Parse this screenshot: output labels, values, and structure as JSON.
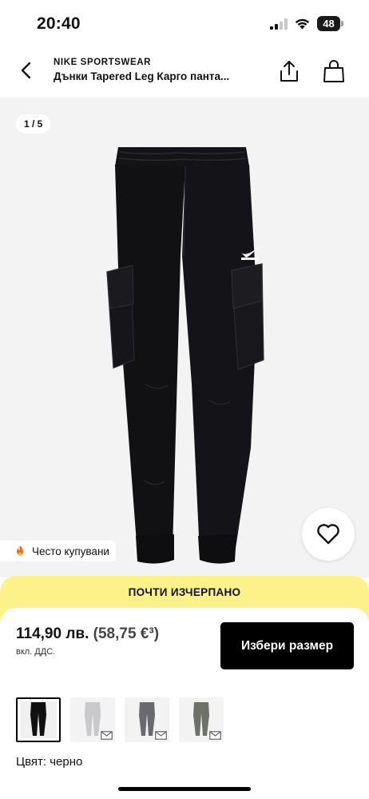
{
  "status_bar": {
    "time": "20:40",
    "battery": "48"
  },
  "header": {
    "brand": "NIKE SPORTSWEAR",
    "title": "Дънки Tapered Leg Карго панта..."
  },
  "gallery": {
    "counter": "1 / 5",
    "popular_badge": "Често купувани"
  },
  "stock_banner": "ПОЧТИ ИЗЧЕРПАНО",
  "buy_panel": {
    "price_bgn": "114,90 лв.",
    "price_eur": "(58,75 €³)",
    "vat_note": "вкл. ДДС.",
    "size_button": "Избери размер"
  },
  "variants": [
    {
      "name": "black",
      "color": "#111111",
      "selected": true,
      "notify": false
    },
    {
      "name": "light-grey",
      "color": "#c9c9cc",
      "selected": false,
      "notify": true
    },
    {
      "name": "dark-grey",
      "color": "#6a6a6e",
      "selected": false,
      "notify": true
    },
    {
      "name": "olive",
      "color": "#6e7266",
      "selected": false,
      "notify": true
    }
  ],
  "color_label": "Цвят: черно",
  "colors": {
    "banner": "#fdf28a",
    "button": "#000000",
    "gallery_bg": "#f3f3f3"
  }
}
